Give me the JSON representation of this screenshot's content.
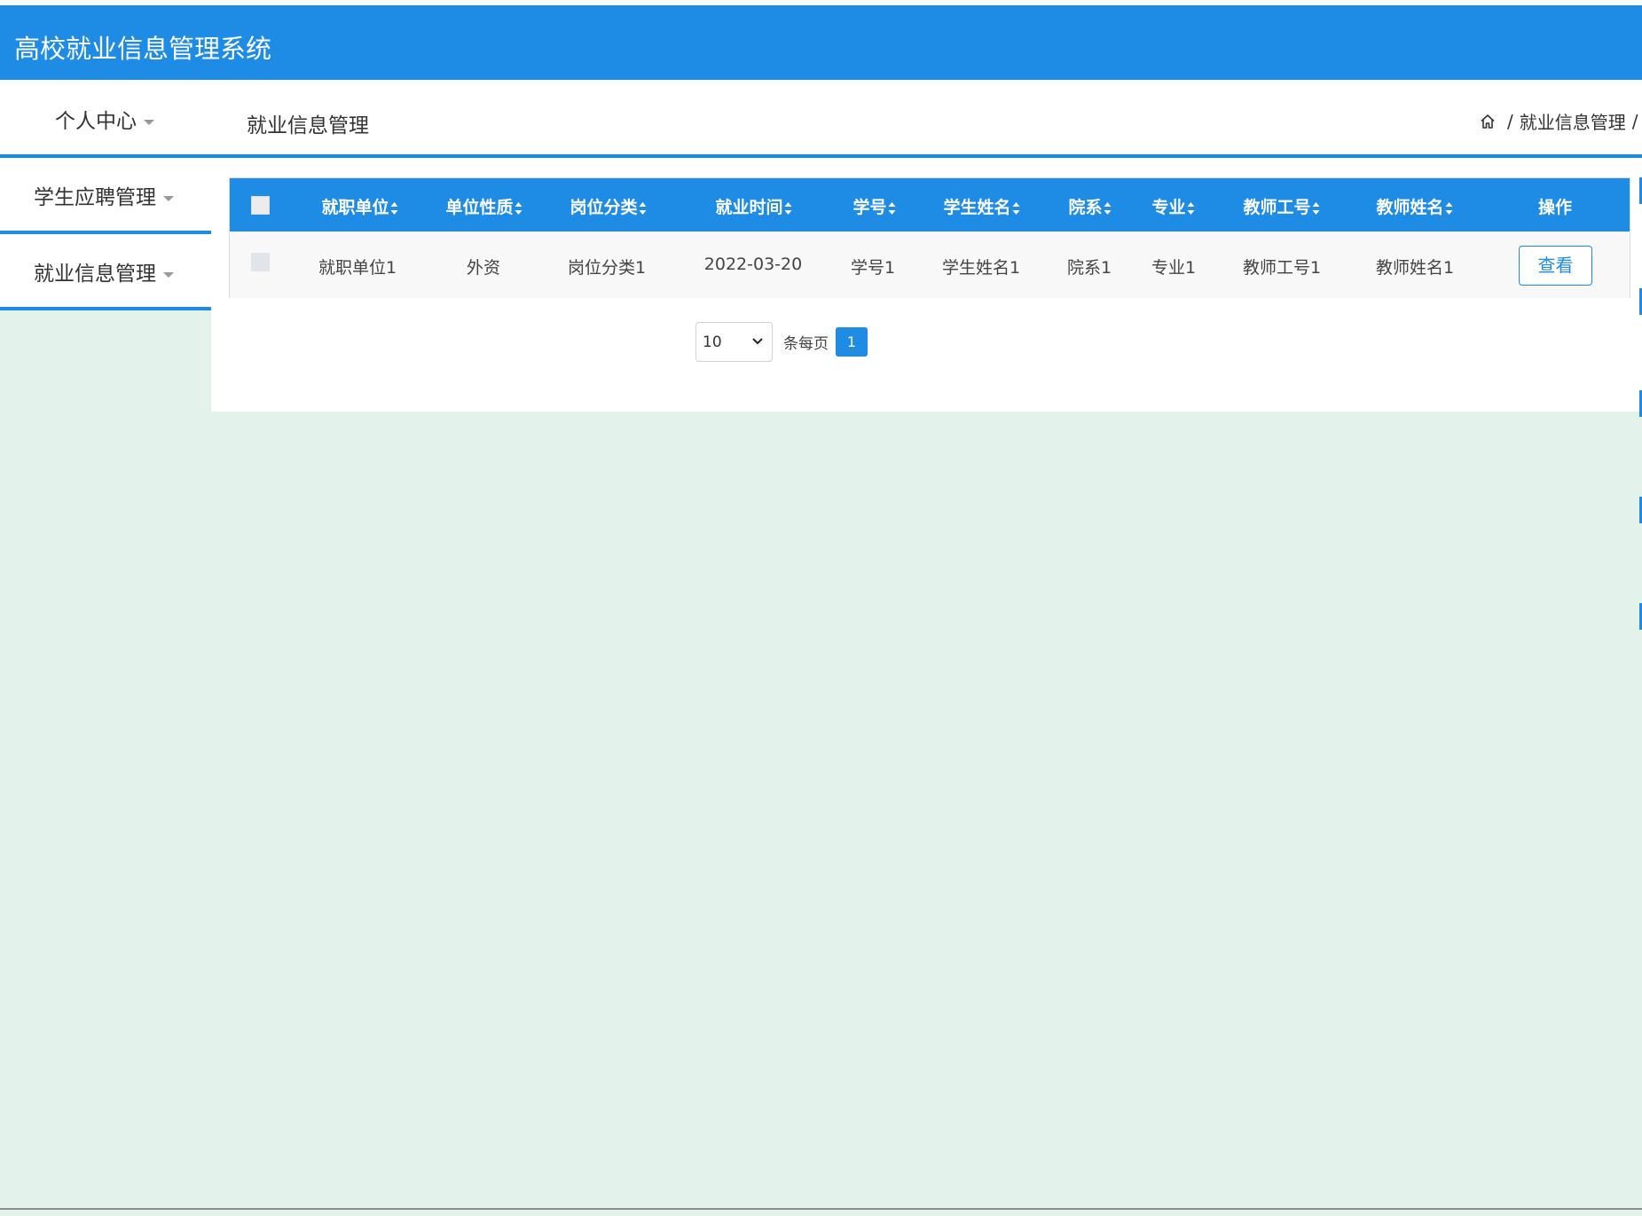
{
  "app": {
    "title": "高校就业信息管理系统"
  },
  "nav": {
    "personal_center": "个人中心",
    "page_title": "就业信息管理",
    "breadcrumb": {
      "home_icon": "home-icon",
      "current": "就业信息管理",
      "sep": "/"
    }
  },
  "sidebar": {
    "items": [
      {
        "label": "学生应聘管理"
      },
      {
        "label": "就业信息管理"
      }
    ]
  },
  "table": {
    "columns": [
      "就职单位",
      "单位性质",
      "岗位分类",
      "就业时间",
      "学号",
      "学生姓名",
      "院系",
      "专业",
      "教师工号",
      "教师姓名",
      "操作"
    ],
    "rows": [
      {
        "cells": [
          "就职单位1",
          "外资",
          "岗位分类1",
          "2022-03-20",
          "学号1",
          "学生姓名1",
          "院系1",
          "专业1",
          "教师工号1",
          "教师姓名1"
        ],
        "action": "查看"
      }
    ]
  },
  "pagination": {
    "page_size": "10",
    "per_page_label": "条每页",
    "current_page": "1"
  },
  "colors": {
    "accent": "#1e8be5",
    "background": "#e4f2ec"
  }
}
